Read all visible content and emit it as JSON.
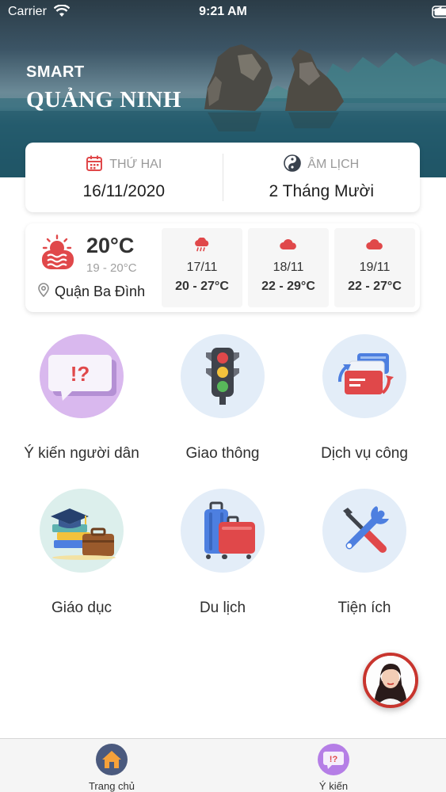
{
  "status_bar": {
    "carrier": "Carrier",
    "time": "9:21 AM"
  },
  "header": {
    "brand_small": "SMART",
    "brand_big": "QUẢNG NINH"
  },
  "date_card": {
    "weekday_label": "THỨ HAI",
    "solar_date": "16/11/2020",
    "lunar_label": "ÂM LỊCH",
    "lunar_date": "2 Tháng Mười"
  },
  "weather": {
    "current_temp": "20°C",
    "current_range": "19 - 20°C",
    "location": "Quận Ba Đình",
    "forecast": [
      {
        "date": "17/11",
        "range": "20 - 27°C",
        "icon": "cloud-rain-icon"
      },
      {
        "date": "18/11",
        "range": "22 - 29°C",
        "icon": "cloud-icon"
      },
      {
        "date": "19/11",
        "range": "22 - 27°C",
        "icon": "cloud-icon"
      }
    ]
  },
  "services": [
    {
      "label": "Ý kiến người dân",
      "icon": "feedback-icon"
    },
    {
      "label": "Giao thông",
      "icon": "traffic-light-icon"
    },
    {
      "label": "Dịch vụ công",
      "icon": "public-service-icon"
    },
    {
      "label": "Giáo dục",
      "icon": "education-icon"
    },
    {
      "label": "Du lịch",
      "icon": "luggage-icon"
    },
    {
      "label": "Tiện ích",
      "icon": "tools-icon"
    }
  ],
  "tabbar": {
    "items": [
      {
        "label": "Trang chủ",
        "icon": "home-icon"
      },
      {
        "label": "Ý kiến",
        "icon": "feedback-icon"
      }
    ]
  },
  "colors": {
    "accent_red": "#e0484a",
    "tile_blue": "#e3edf8",
    "tile_purple": "#d9b8ee",
    "home_tab": "#4b5a7e",
    "feedback_tab": "#b57ee6"
  }
}
